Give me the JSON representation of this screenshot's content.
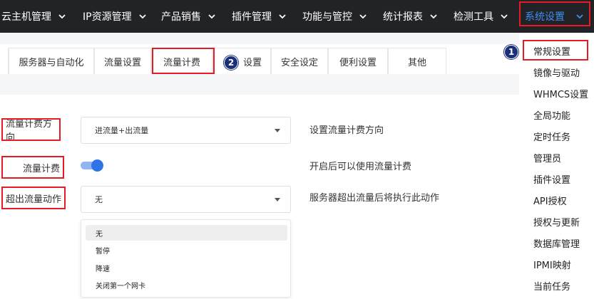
{
  "topnav": {
    "items": [
      {
        "label": "云主机管理"
      },
      {
        "label": "IP资源管理"
      },
      {
        "label": "产品销售"
      },
      {
        "label": "插件管理"
      },
      {
        "label": "功能与管控"
      },
      {
        "label": "统计报表"
      },
      {
        "label": "检测工具"
      },
      {
        "label": "系统设置"
      }
    ],
    "active_color": "#3d8ef0"
  },
  "tabs": [
    {
      "label": "服务器与自动化"
    },
    {
      "label": "流量设置"
    },
    {
      "label": "流量计费"
    },
    {
      "label": "设置"
    },
    {
      "label": "安全设定"
    },
    {
      "label": "便利设置"
    },
    {
      "label": "其他"
    }
  ],
  "annotations": {
    "step1": "1",
    "step2": "2",
    "highlight_color": "#e51c23"
  },
  "form": {
    "direction": {
      "label": "流量计费方向",
      "value": "进流量+出流量",
      "description": "设置流量计费方向"
    },
    "billing": {
      "label": "流量计费",
      "enabled": true,
      "description": "开启后可以使用流量计费"
    },
    "exceed_action": {
      "label": "超出流量动作",
      "value": "无",
      "description": "服务器超出流量后将执行此动作",
      "options": [
        "无",
        "暂停",
        "降速",
        "关闭第一个网卡"
      ]
    }
  },
  "system_menu": {
    "items": [
      "常规设置",
      "镜像与驱动",
      "WHMCS设置",
      "全局功能",
      "定时任务",
      "管理员",
      "插件设置",
      "API授权",
      "授权与更新",
      "数据库管理",
      "IPMI映射",
      "当前任务"
    ]
  }
}
